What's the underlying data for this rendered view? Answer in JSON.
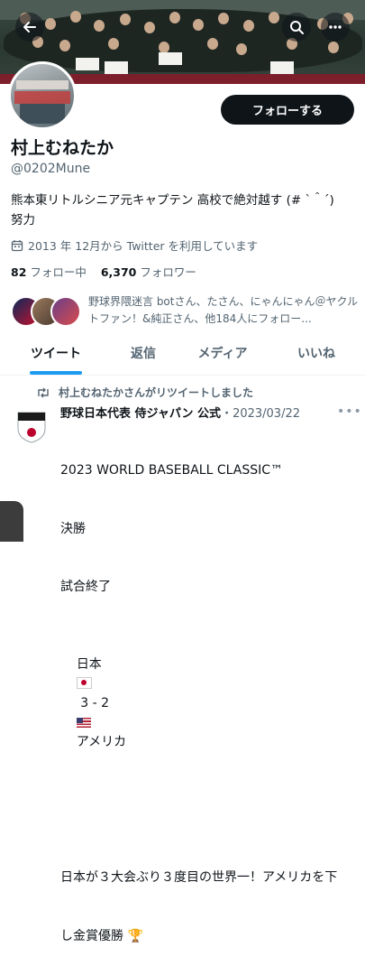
{
  "header": {
    "back_icon": "back-arrow-icon",
    "search_icon": "search-icon",
    "more_icon": "more-horizontal-icon"
  },
  "profile": {
    "name": "村上むねたか",
    "handle": "@0202Mune",
    "follow_label": "フォローする",
    "bio_line1": "熊本東リトルシニア元キャプテン 高校で絶対越す (# `＾´)",
    "bio_line2": "努力",
    "joined": "2013 年 12月から Twitter を利用しています",
    "following_count": "82",
    "following_label": "フォロー中",
    "followers_count": "6,370",
    "followers_label": "フォロワー",
    "followers_you_know": "野球界隈迷言 botさん、たさん、にゃんにゃん＠ヤクルトファン！&純正さん、他184人にフォロー..."
  },
  "tabs": [
    {
      "label": "ツイート",
      "active": true
    },
    {
      "label": "返信",
      "active": false
    },
    {
      "label": "メディア",
      "active": false
    },
    {
      "label": "いいね",
      "active": false
    }
  ],
  "tweet": {
    "retweet_text": "村上むねたかさんがリツイートしました",
    "author_name": "野球日本代表 侍ジャパン 公式",
    "date": "・2023/03/22",
    "more": "•••",
    "avatar_text": "SAMURAI JAPAN",
    "line1": "2023 WORLD BASEBALL CLASSIC™",
    "line2": "決勝",
    "line3": "試合終了",
    "line4_a": "日本",
    "line4_b": " 3 - 2 ",
    "line4_c": "アメリカ",
    "line5": "日本が３大会ぶり３度目の世界一！アメリカを下",
    "line6": "し金賞優勝"
  },
  "colors": {
    "accent": "#1d9bf0",
    "text_primary": "#0f1419",
    "text_secondary": "#536471"
  }
}
